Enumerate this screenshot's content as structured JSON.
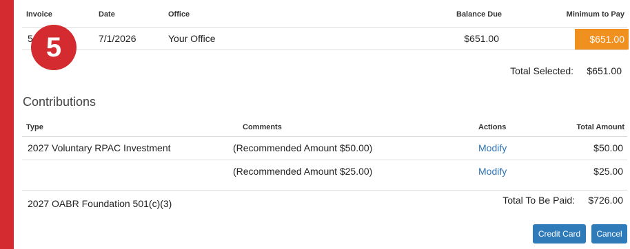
{
  "badge": {
    "number": "5"
  },
  "invoice_table": {
    "headers": {
      "invoice": "Invoice",
      "date": "Date",
      "office": "Office",
      "balance_due": "Balance Due",
      "minimum_to_pay": "Minimum to Pay"
    },
    "row": {
      "invoice_partial": "5",
      "date": "7/1/2026",
      "office": "Your Office",
      "balance_due": "$651.00",
      "minimum_to_pay": "$651.00"
    },
    "total_selected_label": "Total Selected:",
    "total_selected_value": "$651.00"
  },
  "contributions": {
    "title": "Contributions",
    "headers": {
      "type": "Type",
      "comments": "Comments",
      "actions": "Actions",
      "total_amount": "Total Amount"
    },
    "rows": [
      {
        "type": "2027 Voluntary RPAC Investment",
        "comment": "(Recommended Amount $50.00)",
        "action": "Modify",
        "amount": "$50.00"
      },
      {
        "type": "",
        "comment": "(Recommended Amount $25.00)",
        "action": "Modify",
        "amount": "$25.00"
      }
    ],
    "footer_type": "2027 OABR Foundation 501(c)(3)",
    "total_label": "Total To Be Paid:",
    "total_value": "$726.00"
  },
  "buttons": {
    "credit_card": "Credit Card",
    "cancel": "Cancel"
  },
  "colors": {
    "accent_red": "#d32b2f",
    "orange": "#f0901e",
    "link_blue": "#2f74b5",
    "button_blue": "#2f7ab8"
  }
}
